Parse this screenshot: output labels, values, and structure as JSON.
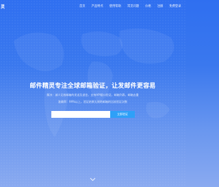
{
  "header": {
    "logo": "灵",
    "nav": [
      "首页",
      "产品特点",
      "使用帮助",
      "常见问题",
      "价格",
      "注册",
      "免费登录"
    ]
  },
  "hero": {
    "title": "邮件精灵专注全球邮箱验证，让发邮件更容易",
    "desc_line1": "解决：减少无效邮箱的发送及退信，支持API接口验证，邮箱列表，邮箱去重",
    "desc_line2": "准确率：99%以上，验证结果无效地邮箱的比较验证次数"
  },
  "search": {
    "placeholder": "",
    "button_label": "立即验证"
  },
  "icons": {
    "scroll_down": "chevron-down-icon"
  },
  "colors": {
    "background_top": "#2f6ff0",
    "background_bottom": "#8aaaf0",
    "button": "#2ea0f8"
  }
}
